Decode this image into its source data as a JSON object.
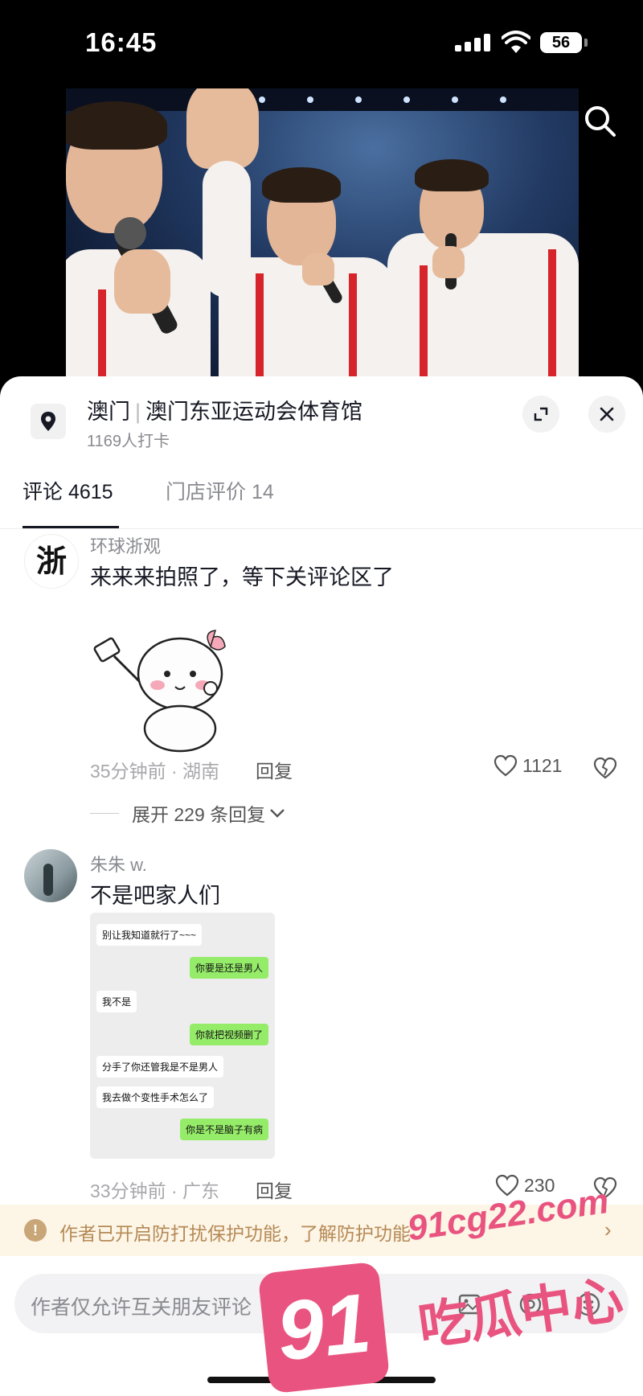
{
  "status_bar": {
    "time": "16:45",
    "battery": "56"
  },
  "location": {
    "city": "澳门",
    "venue": "澳门东亚运动会体育馆",
    "checkins": "1169人打卡"
  },
  "tabs": [
    {
      "label": "评论 4615",
      "active": true
    },
    {
      "label": "门店评价 14",
      "active": false
    }
  ],
  "comments": [
    {
      "user": "环球浙观",
      "avatar_text": "浙",
      "text": "来来来拍照了，等下关评论区了",
      "meta": "35分钟前 · 湖南",
      "reply_label": "回复",
      "likes": "1121"
    },
    {
      "user": "朱朱 w.",
      "text": "不是吧家人们",
      "meta": "33分钟前 · 广东",
      "reply_label": "回复",
      "likes": "230",
      "chat_screenshot": [
        {
          "side": "left",
          "text": "别让我知道就行了~~~"
        },
        {
          "side": "right",
          "text": "你要是还是男人"
        },
        {
          "side": "left",
          "text": "我不是"
        },
        {
          "side": "right",
          "text": "你就把视频删了"
        },
        {
          "side": "left",
          "text": "分手了你还管我是不是男人"
        },
        {
          "side": "left",
          "text": "我去做个变性手术怎么了"
        },
        {
          "side": "right",
          "text": "你是不是脑子有病"
        }
      ]
    }
  ],
  "expand_replies": "展开 229 条回复",
  "notice": "作者已开启防打扰保护功能，了解防护功能",
  "input_placeholder": "作者仅允许互关朋友评论",
  "watermark": {
    "badge": "91",
    "domain": "91cg22.com",
    "name": "吃瓜中心"
  },
  "colors": {
    "accent_pink": "#e8547f",
    "notice_bg": "#fdf5e6",
    "notice_text": "#b58a56",
    "chat_green": "#95ec69"
  }
}
